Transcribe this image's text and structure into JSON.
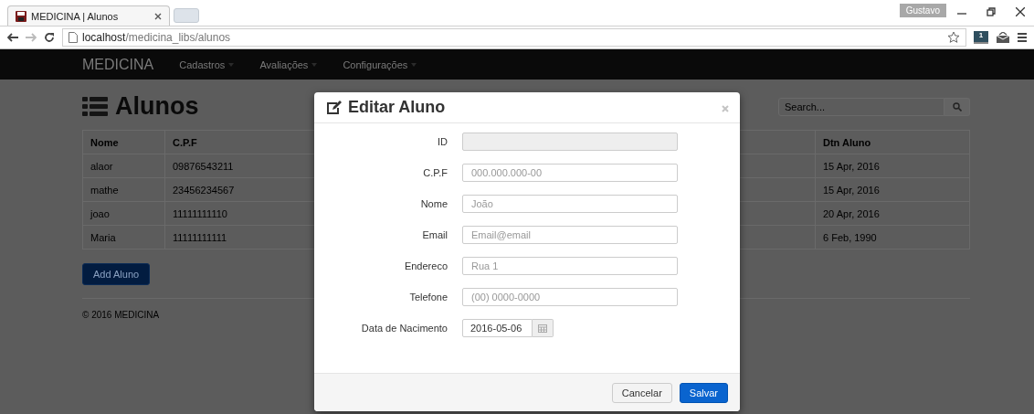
{
  "browser": {
    "tab": {
      "title": "MEDICINA | Alunos"
    },
    "profile": "Gustavo",
    "address": {
      "host": "localhost",
      "path": "/medicina_libs/alunos"
    },
    "forward_disabled": true,
    "extension_badge": "1"
  },
  "navbar": {
    "brand": "MEDICINA",
    "menus": [
      "Cadastros",
      "Avaliações",
      "Configurações"
    ]
  },
  "page": {
    "title": "Alunos",
    "search": {
      "placeholder": "Search..."
    },
    "table": {
      "columns": [
        "Nome",
        "C.P.F",
        "Dtn Aluno"
      ],
      "rows": [
        [
          "alaor",
          "09876543211",
          "15 Apr, 2016"
        ],
        [
          "mathe",
          "23456234567",
          "15 Apr, 2016"
        ],
        [
          "joao",
          "11111111110",
          "20 Apr, 2016"
        ],
        [
          "Maria",
          "11111111111",
          "6 Feb, 1990"
        ]
      ]
    },
    "add_button": "Add Aluno",
    "footer": "© 2016 MEDICINA"
  },
  "modal": {
    "title": "Editar Aluno",
    "fields": [
      {
        "kind": "text",
        "label": "ID",
        "disabled": true
      },
      {
        "kind": "text",
        "label": "C.P.F",
        "placeholder": "000.000.000-00",
        "disabled": false
      },
      {
        "kind": "text",
        "label": "Nome",
        "placeholder": "João",
        "disabled": false
      },
      {
        "kind": "text",
        "label": "Email",
        "placeholder": "Email@email",
        "disabled": false
      },
      {
        "kind": "text",
        "label": "Endereco",
        "placeholder": "Rua 1",
        "disabled": false
      },
      {
        "kind": "text",
        "label": "Telefone",
        "placeholder": "(00) 0000-0000",
        "disabled": false
      },
      {
        "kind": "date",
        "label": "Data de Nacimento",
        "value": "2016-05-06",
        "disabled": false
      }
    ],
    "buttons": [
      "Cancelar",
      "Salvar"
    ]
  }
}
